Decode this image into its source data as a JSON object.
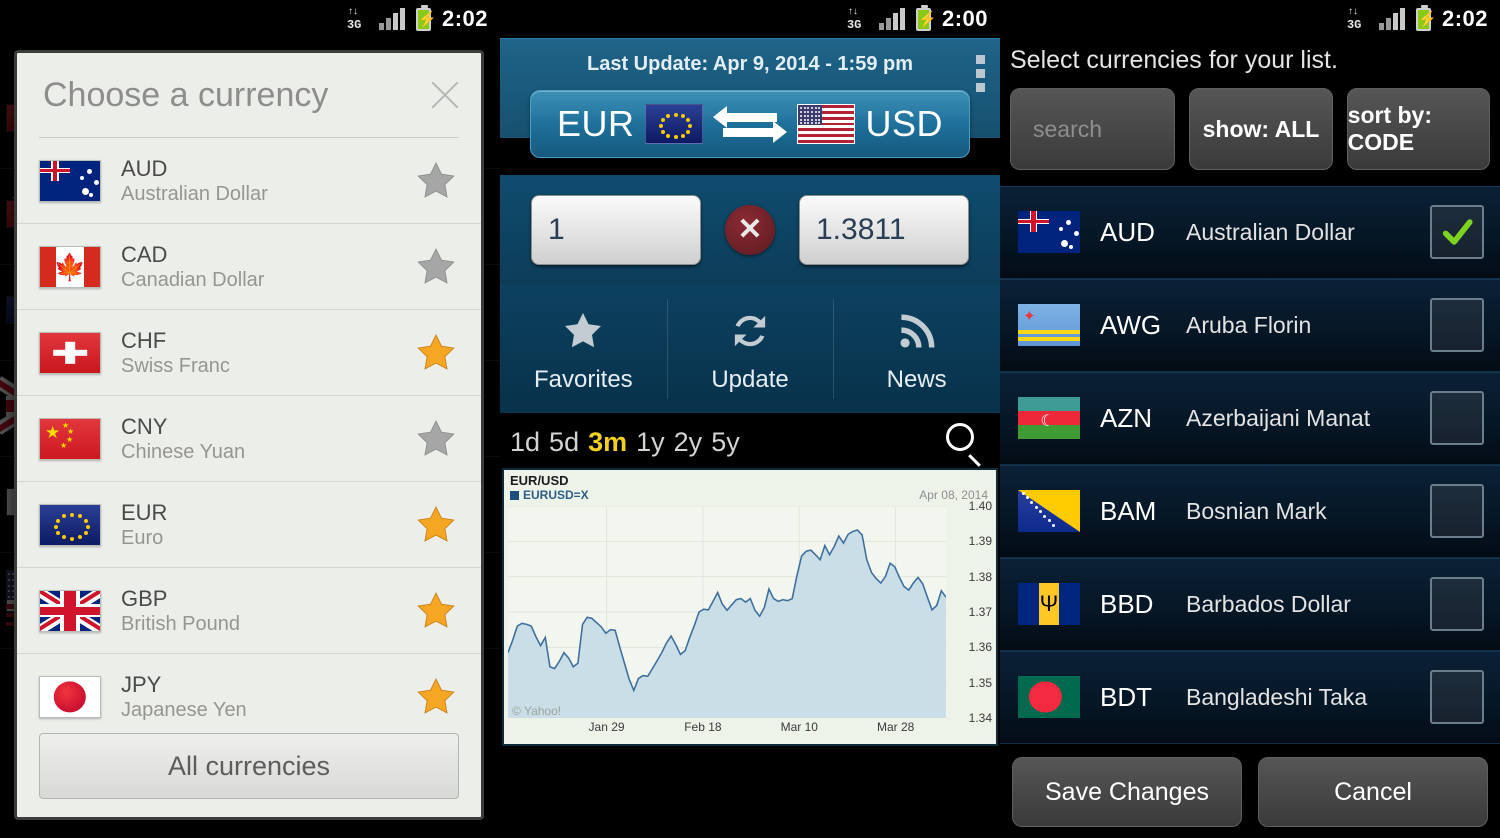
{
  "status_bars": [
    {
      "network": "3G",
      "time": "2:02"
    },
    {
      "network": "3G",
      "time": "2:00"
    },
    {
      "network": "3G",
      "time": "2:02"
    }
  ],
  "left_panel": {
    "dialog": {
      "title": "Choose a currency",
      "close_icon": "close-icon",
      "all_currencies_label": "All currencies",
      "rows": [
        {
          "code": "AUD",
          "name": "Australian Dollar",
          "flag": "au",
          "favorite": false
        },
        {
          "code": "CAD",
          "name": "Canadian Dollar",
          "flag": "ca",
          "favorite": false
        },
        {
          "code": "CHF",
          "name": "Swiss Franc",
          "flag": "ch",
          "favorite": true
        },
        {
          "code": "CNY",
          "name": "Chinese Yuan",
          "flag": "cn",
          "favorite": false
        },
        {
          "code": "EUR",
          "name": "Euro",
          "flag": "eu",
          "favorite": true
        },
        {
          "code": "GBP",
          "name": "British Pound",
          "flag": "gb",
          "favorite": true
        },
        {
          "code": "JPY",
          "name": "Japanese Yen",
          "flag": "jp",
          "favorite": true
        }
      ]
    },
    "star_on_color": "#f5a623",
    "star_off_color": "#a6a6a6"
  },
  "mid_panel": {
    "last_update": "Last Update: Apr 9, 2014 - 1:59 pm",
    "overflow_icon": "overflow-menu-icon",
    "pair": {
      "from_code": "EUR",
      "from_flag": "eu",
      "to_code": "USD",
      "to_flag": "us",
      "swap_icon": "swap-arrows-icon"
    },
    "converter": {
      "amount": "1",
      "multiply_symbol": "✕",
      "rate": "1.3811"
    },
    "actions": [
      {
        "label": "Favorites",
        "icon": "star-icon"
      },
      {
        "label": "Update",
        "icon": "refresh-icon"
      },
      {
        "label": "News",
        "icon": "rss-icon"
      }
    ],
    "ranges": [
      {
        "label": "1d",
        "active": false
      },
      {
        "label": "5d",
        "active": false
      },
      {
        "label": "3m",
        "active": true
      },
      {
        "label": "1y",
        "active": false
      },
      {
        "label": "2y",
        "active": false
      },
      {
        "label": "5y",
        "active": false
      }
    ],
    "search_icon": "search-icon",
    "active_range_color": "#f2d022"
  },
  "chart_data": {
    "type": "area",
    "title": "EUR/USD",
    "legend": [
      "EURUSD=X"
    ],
    "annotation": "Apr 08, 2014",
    "watermark": "© Yahoo!",
    "xlabel": "",
    "ylabel": "",
    "ylim": [
      1.34,
      1.4
    ],
    "yticks": [
      "1.40",
      "1.39",
      "1.38",
      "1.37",
      "1.36",
      "1.35",
      "1.34"
    ],
    "xticks": [
      "Jan 29",
      "Feb 18",
      "Mar 10",
      "Mar 28"
    ],
    "xtick_positions": [
      0.225,
      0.445,
      0.665,
      0.885
    ],
    "grid": true,
    "line_color": "#3f6f9e",
    "fill_color": "#c3d9e6",
    "series": [
      {
        "name": "EURUSD=X",
        "values": [
          1.3585,
          1.362,
          1.366,
          1.3668,
          1.3665,
          1.366,
          1.363,
          1.3605,
          1.3628,
          1.3545,
          1.354,
          1.356,
          1.3585,
          1.357,
          1.3545,
          1.3555,
          1.3665,
          1.3685,
          1.3682,
          1.367,
          1.3658,
          1.364,
          1.365,
          1.3648,
          1.36,
          1.3555,
          1.351,
          1.3478,
          1.3512,
          1.352,
          1.3518,
          1.354,
          1.3562,
          1.3585,
          1.3612,
          1.3632,
          1.3608,
          1.358,
          1.359,
          1.3628,
          1.3662,
          1.37,
          1.3708,
          1.3706,
          1.373,
          1.3755,
          1.3722,
          1.3705,
          1.372,
          1.3735,
          1.3738,
          1.3728,
          1.3738,
          1.3705,
          1.3688,
          1.3712,
          1.3765,
          1.3738,
          1.373,
          1.3735,
          1.3732,
          1.3738,
          1.3802,
          1.3858,
          1.3872,
          1.3875,
          1.3862,
          1.3848,
          1.3888,
          1.3862,
          1.3885,
          1.3915,
          1.3895,
          1.392,
          1.3928,
          1.3932,
          1.3918,
          1.3848,
          1.3812,
          1.3795,
          1.3782,
          1.38,
          1.3838,
          1.3828,
          1.3798,
          1.3772,
          1.3762,
          1.3782,
          1.3798,
          1.378,
          1.3742,
          1.3706,
          1.3718,
          1.376,
          1.3742
        ]
      }
    ]
  },
  "right_panel": {
    "title": "Select currencies for your list.",
    "toolbar": {
      "search_placeholder": "search",
      "show_label": "show: ALL",
      "sort_label": "sort by: CODE"
    },
    "rows": [
      {
        "code": "AUD",
        "name": "Australian Dollar",
        "flag": "au",
        "checked": true
      },
      {
        "code": "AWG",
        "name": "Aruba Florin",
        "flag": "aw",
        "checked": false
      },
      {
        "code": "AZN",
        "name": "Azerbaijani Manat",
        "flag": "az",
        "checked": false
      },
      {
        "code": "BAM",
        "name": "Bosnian Mark",
        "flag": "ba",
        "checked": false
      },
      {
        "code": "BBD",
        "name": "Barbados Dollar",
        "flag": "bb",
        "checked": false
      },
      {
        "code": "BDT",
        "name": "Bangladeshi Taka",
        "flag": "bd",
        "checked": false
      }
    ],
    "save_label": "Save Changes",
    "cancel_label": "Cancel",
    "check_color": "#7ed321"
  }
}
